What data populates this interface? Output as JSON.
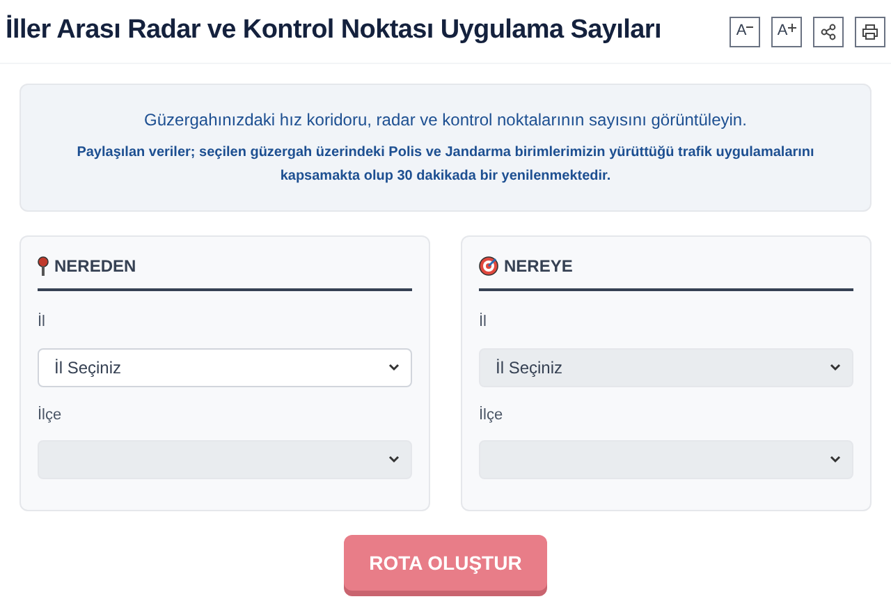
{
  "title": "İller Arası Radar ve Kontrol Noktası Uygulama Sayıları",
  "toolbar": [
    {
      "kind": "font-decrease",
      "label": "A"
    },
    {
      "kind": "font-increase",
      "label": "A"
    },
    {
      "kind": "share"
    },
    {
      "kind": "print"
    }
  ],
  "info": {
    "lead": "Güzergahınızdaki hız koridoru, radar ve kontrol noktalarının sayısını görüntüleyin.",
    "note": "Paylaşılan veriler; seçilen güzergah üzerindeki Polis ve Jandarma birimlerimizin yürüttüğü trafik uygulamalarını kapsamakta olup 30 dakikada bir yenilenmektedir."
  },
  "panels": [
    {
      "kind": "origin",
      "heading": "NEREDEN",
      "fields": [
        {
          "label": "İl",
          "value": "İl Seçiniz",
          "disabled": false
        },
        {
          "label": "İlçe",
          "disabled": true
        }
      ]
    },
    {
      "kind": "destination",
      "heading": "NEREYE",
      "fields": [
        {
          "label": "İl",
          "value": "İl Seçiniz",
          "disabled": true
        },
        {
          "label": "İlçe",
          "disabled": true
        }
      ]
    }
  ],
  "submit": {
    "label": "ROTA OLUŞTUR",
    "disabled": true
  }
}
